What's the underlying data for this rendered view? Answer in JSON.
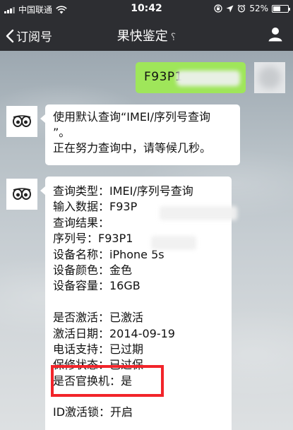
{
  "status_bar": {
    "carrier": "中国联通",
    "time": "10:42",
    "battery_text": "52%",
    "battery_level": 0.52,
    "icons": [
      "signal-icon",
      "wifi-icon",
      "lock-rotation-icon",
      "location-icon",
      "alarm-icon",
      "battery-icon"
    ]
  },
  "nav": {
    "back_label": "订阅号",
    "title": "果快鉴定",
    "icons": [
      "chevron-left-icon",
      "ear-icon",
      "user-icon"
    ]
  },
  "chat": {
    "outgoing": {
      "text": "F93P1"
    },
    "reply1": {
      "line1": "使用默认查询“IMEI/序列号查询",
      "line2": "”。",
      "line3": "正在努力查询中，请等候几秒。"
    },
    "reply2": {
      "lines": [
        "查询类型：IMEI/序列号查询",
        "输入数据：F93P",
        "查询结果：",
        "序列号：F93P1",
        "设备名称：iPhone 5s",
        "设备颜色：金色",
        "设备容量：16GB",
        "",
        "是否激活：已激活",
        "激活日期：2014-09-19",
        "电话支持：已过期",
        "保修状态：已过保",
        "是否官换机：是",
        "",
        "ID激活锁：开启"
      ]
    }
  },
  "colors": {
    "bar_bg": "#2d2e32",
    "outgoing_bubble": "#9fe65a",
    "highlight_box": "#f2242a"
  }
}
